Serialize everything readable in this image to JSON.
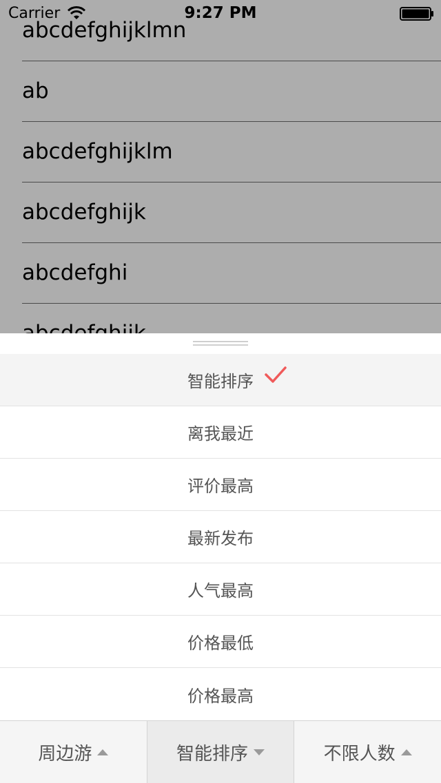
{
  "status_bar": {
    "carrier": "Carrier",
    "time": "9:27 PM",
    "wifi_icon": "wifi-icon",
    "battery_icon": "battery-icon"
  },
  "list": {
    "items": [
      "abcdefghijklmn",
      "ab",
      "abcdefghijklm",
      "abcdefghijk",
      "abcdefghi",
      "abcdefghijk"
    ]
  },
  "sort_panel": {
    "options": [
      "智能排序",
      "离我最近",
      "评价最高",
      "最新发布",
      "人气最高",
      "价格最低",
      "价格最高"
    ],
    "selected_index": 0,
    "check_icon": "checkmark-icon",
    "check_color": "#f05a5a"
  },
  "tab_bar": {
    "tabs": [
      {
        "label": "周边游",
        "arrow": "up"
      },
      {
        "label": "智能排序",
        "arrow": "down",
        "active": true
      },
      {
        "label": "不限人数",
        "arrow": "up"
      }
    ]
  }
}
